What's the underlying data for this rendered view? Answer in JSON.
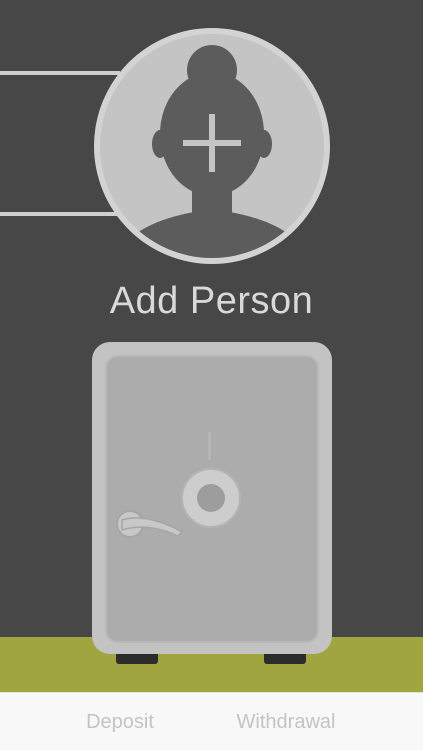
{
  "add_person": {
    "label": "Add Person",
    "icon": "add-person-icon"
  },
  "safe": {
    "icon": "safe-icon"
  },
  "tabs": [
    {
      "label": "Deposit"
    },
    {
      "label": "Withdrawal"
    }
  ],
  "colors": {
    "background": "#474747",
    "accent_floor": "#a0a540",
    "avatar_fill": "#c8c8c8",
    "silhouette": "#5c5c5c",
    "tab_text": "#c4c4c4"
  }
}
